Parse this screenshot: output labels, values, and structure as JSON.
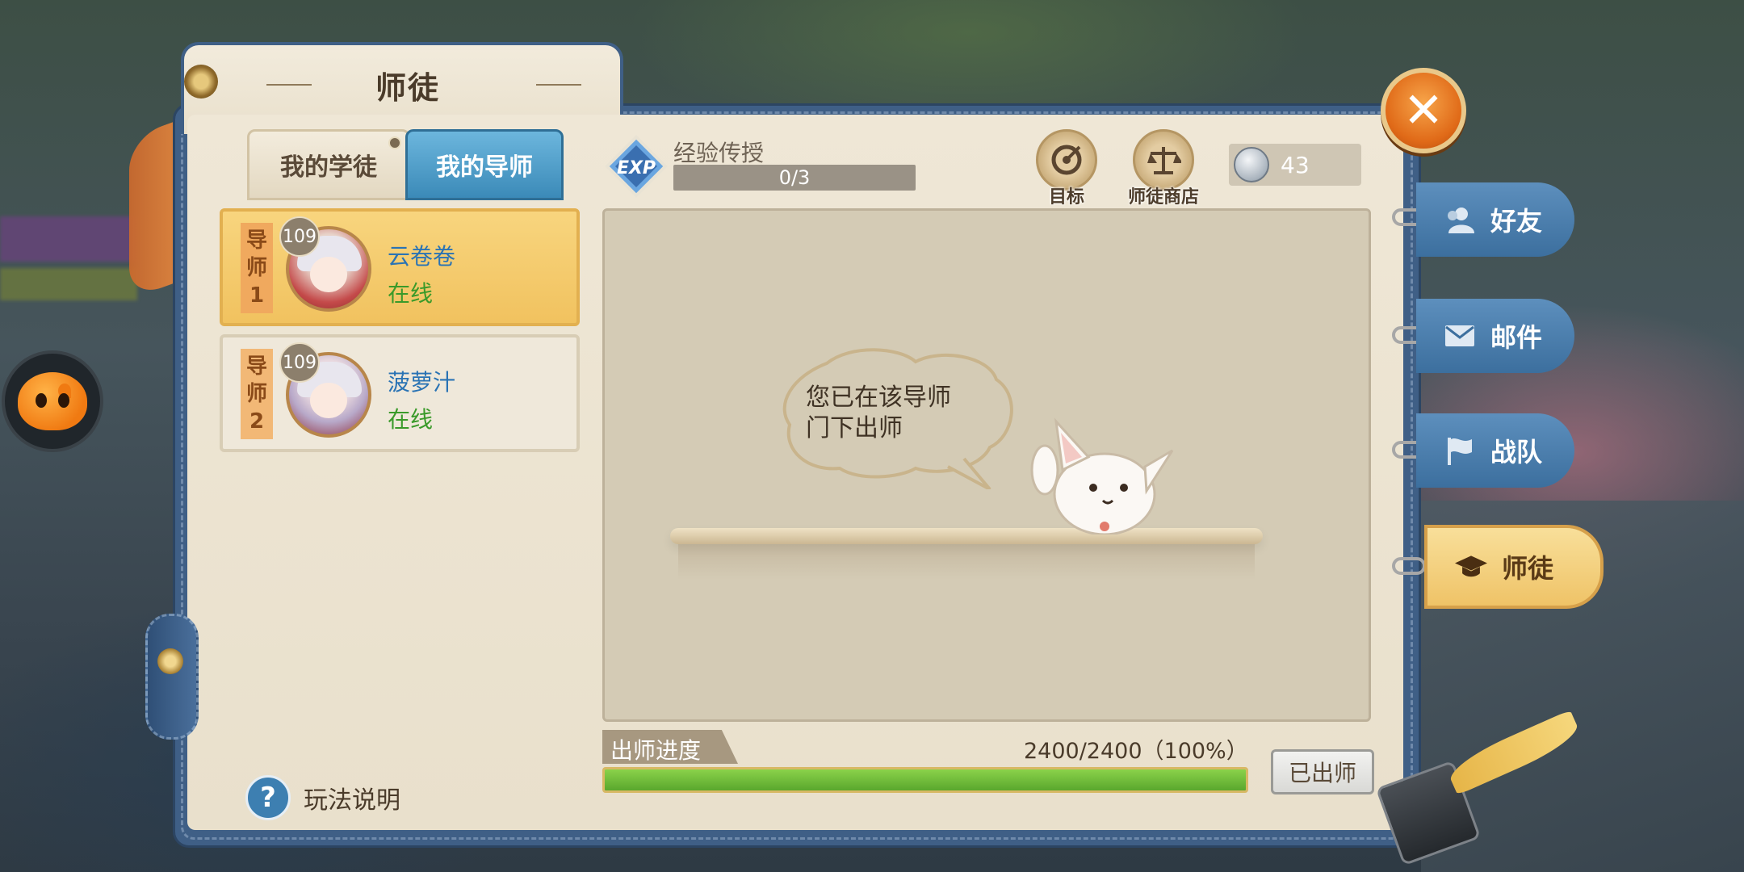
{
  "panel": {
    "title": "师徒",
    "close_icon": "close-icon"
  },
  "tabs": [
    {
      "label": "我的学徒",
      "active": false
    },
    {
      "label": "我的导师",
      "active": true
    }
  ],
  "exp": {
    "badge": "EXP",
    "label": "经验传授",
    "progress_text": "0/3",
    "progress": 0
  },
  "top_buttons": {
    "goal": {
      "label": "目标",
      "icon": "target-icon"
    },
    "shop": {
      "label": "师徒商店",
      "icon": "scales-icon"
    }
  },
  "currency": {
    "icon": "coin-icon",
    "value": "43"
  },
  "mentors": [
    {
      "rank_label": [
        "导",
        "师",
        "1"
      ],
      "level": "109",
      "name": "云卷卷",
      "status": "在线",
      "selected": true
    },
    {
      "rank_label": [
        "导",
        "师",
        "2"
      ],
      "level": "109",
      "name": "菠萝汁",
      "status": "在线",
      "selected": false
    }
  ],
  "help": {
    "label": "玩法说明",
    "icon": "question-icon"
  },
  "message": {
    "line1": "您已在该导师",
    "line2": "门下出师"
  },
  "graduation": {
    "label": "出师进度",
    "value_text": "2400/2400（100%）",
    "progress": 1.0,
    "button": "已出师"
  },
  "side_tabs": [
    {
      "label": "好友",
      "icon": "friend-icon",
      "active": false
    },
    {
      "label": "邮件",
      "icon": "mail-icon",
      "active": false
    },
    {
      "label": "战队",
      "icon": "flag-icon",
      "active": false
    },
    {
      "label": "师徒",
      "icon": "mortarboard-icon",
      "active": true
    }
  ],
  "colors": {
    "accent_blue": "#3b8ab8",
    "selected_card": "#f1c25f",
    "online_green": "#3a9a2a",
    "name_blue": "#2a73b4",
    "progress_green": "#5aa72d",
    "close_orange": "#e06a18"
  }
}
